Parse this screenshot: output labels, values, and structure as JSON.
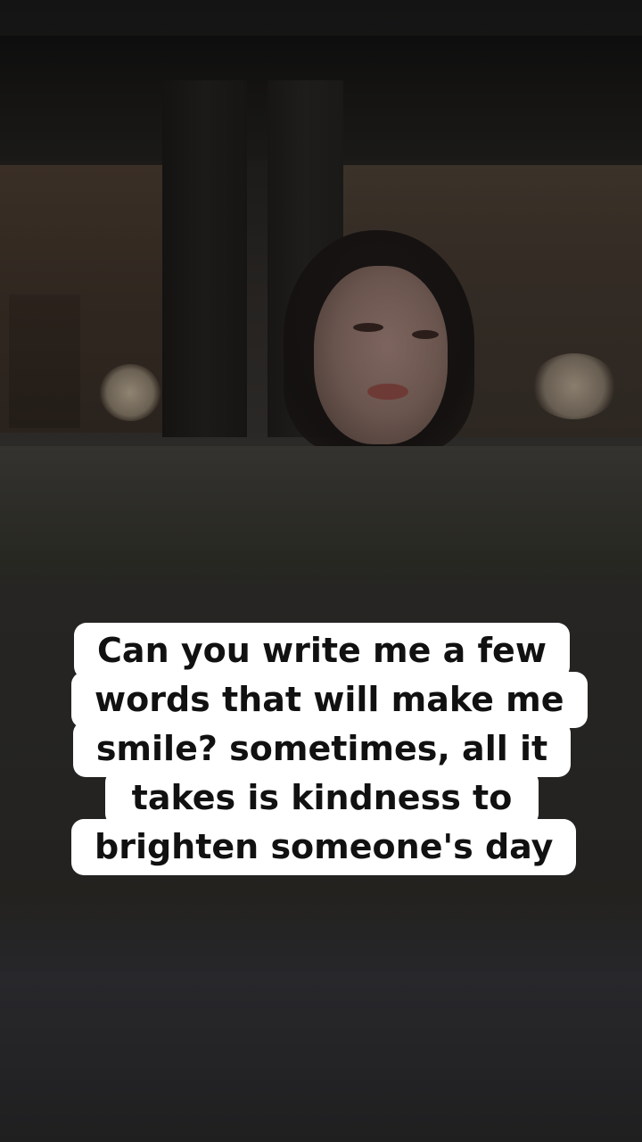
{
  "image": {
    "scene": "dim-room-window-portrait"
  },
  "caption": {
    "lines": [
      "Can you write me a few",
      "words that will make me",
      "smile? sometimes, all it",
      "takes is kindness to",
      "brighten someone's day"
    ],
    "text_color": "#111111",
    "background_color": "#ffffff"
  }
}
